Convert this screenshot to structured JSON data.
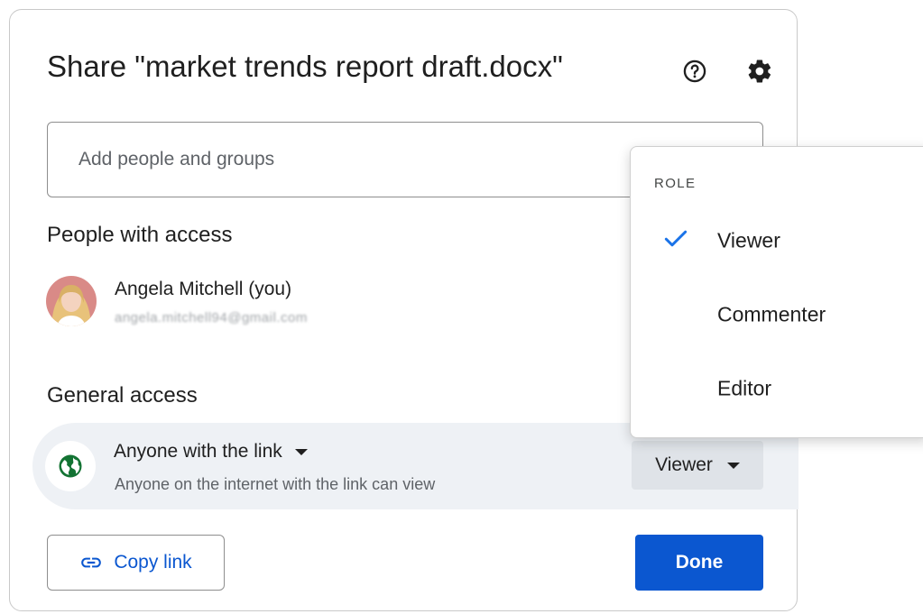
{
  "dialog": {
    "title": "Share \"market trends report draft.docx\"",
    "help_icon": "help-circle-icon",
    "settings_icon": "gear-icon"
  },
  "add_people": {
    "placeholder": "Add people and groups",
    "value": ""
  },
  "people_section": {
    "heading": "People with access",
    "users": [
      {
        "name": "Angela Mitchell (you)",
        "email": "angela.mitchell94@gmail.com"
      }
    ]
  },
  "general_access": {
    "heading": "General access",
    "scope_label": "Anyone with the link",
    "description": "Anyone on the internet with the link can view",
    "role": "Viewer",
    "icon": "globe-icon"
  },
  "footer": {
    "copy_label": "Copy link",
    "copy_icon": "link-icon",
    "done_label": "Done"
  },
  "role_menu": {
    "heading": "ROLE",
    "items": [
      {
        "label": "Viewer",
        "selected": true
      },
      {
        "label": "Commenter",
        "selected": false
      },
      {
        "label": "Editor",
        "selected": false
      }
    ]
  },
  "colors": {
    "accent": "#0b57d0",
    "check": "#1a73e8",
    "globe": "#137333",
    "access_row_bg": "#eef1f5"
  }
}
